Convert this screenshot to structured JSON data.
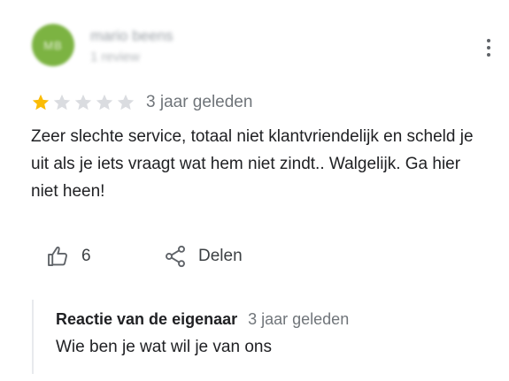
{
  "reviewer": {
    "name": "mario beens",
    "meta": "1 review",
    "avatar_initials": "MB",
    "avatar_color": "#7cb342"
  },
  "menu": {
    "icon": "more-vertical-icon"
  },
  "rating": {
    "value": 1,
    "max": 5,
    "filled_color": "#fbbc04",
    "empty_color": "#dadce0"
  },
  "review": {
    "date": "3 jaar geleden",
    "text": "Zeer slechte service, totaal niet klantvriendelijk en scheld je uit als je iets vraagt wat hem niet zindt.. Walgelijk. Ga hier niet heen!"
  },
  "actions": {
    "like_icon": "thumb-up-icon",
    "like_count": "6",
    "share_icon": "share-icon",
    "share_label": "Delen"
  },
  "owner_response": {
    "label": "Reactie van de eigenaar",
    "date": "3 jaar geleden",
    "text": "Wie ben je wat wil je van ons"
  }
}
